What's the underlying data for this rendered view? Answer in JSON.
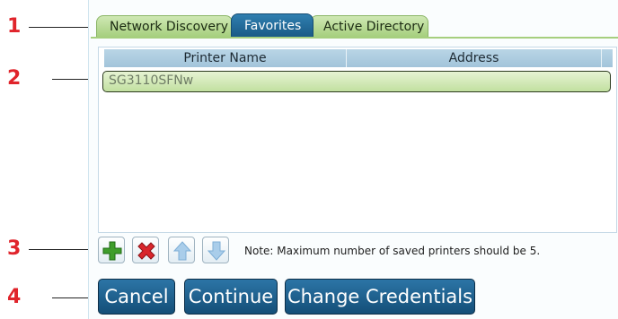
{
  "callouts": [
    "1",
    "2",
    "3",
    "4"
  ],
  "tabs": [
    {
      "label": "Network Discovery",
      "active": false
    },
    {
      "label": "Favorites",
      "active": true
    },
    {
      "label": "Active Directory",
      "active": false
    }
  ],
  "list": {
    "columns": [
      "Printer Name",
      "Address"
    ],
    "rows": [
      {
        "name": "SG3110SFNw",
        "address": "",
        "selected": true
      }
    ]
  },
  "toolbar": {
    "icons": [
      "add-icon",
      "remove-icon",
      "move-up-icon",
      "move-down-icon"
    ],
    "note": "Note: Maximum number of saved printers should be 5."
  },
  "buttons": {
    "cancel": "Cancel",
    "continue": "Continue",
    "change_credentials": "Change Credentials"
  },
  "colors": {
    "callout": "#e0242b",
    "tab_inactive": "#a6cf7e",
    "tab_active": "#1a5a86",
    "button": "#144f78",
    "selected_row": "#c2e0a0"
  }
}
